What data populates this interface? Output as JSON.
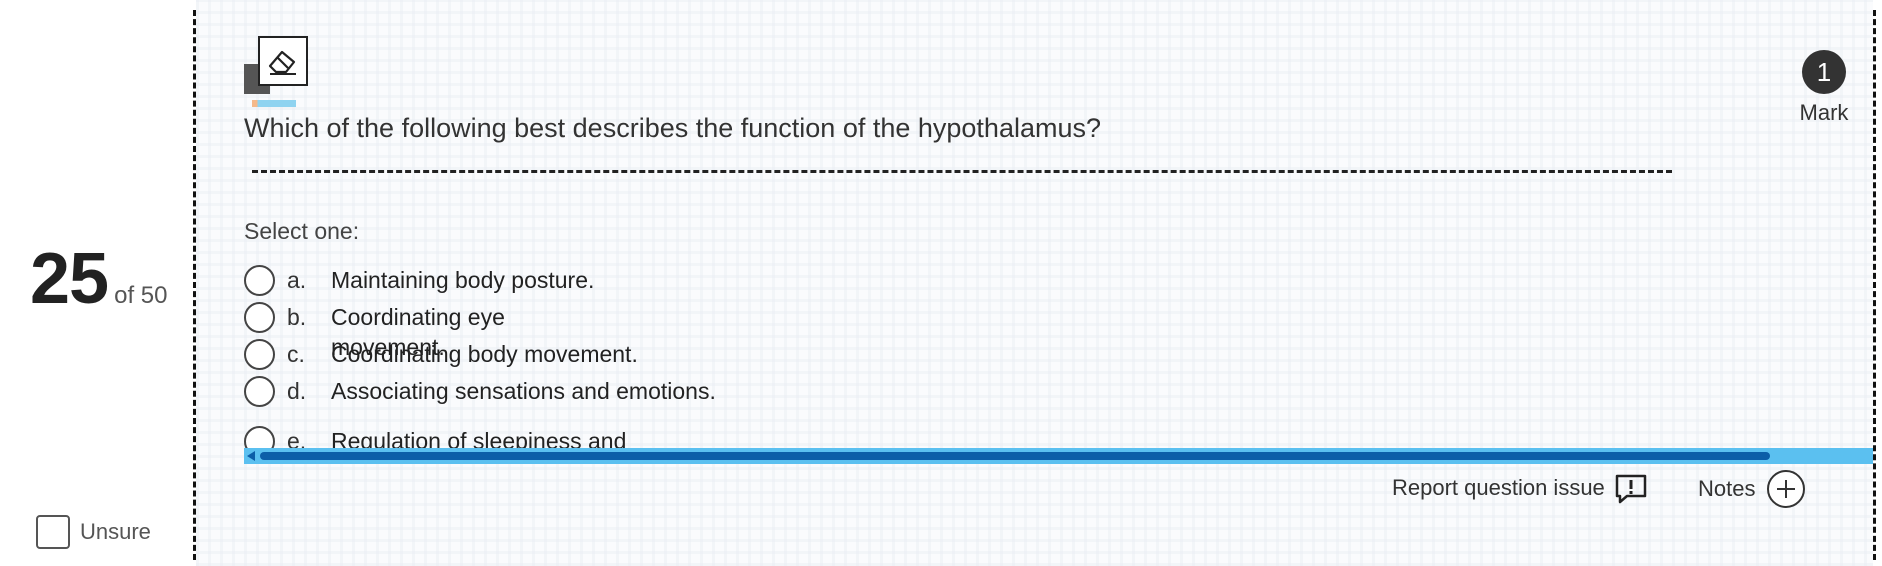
{
  "question_nav": {
    "number": "25",
    "of_total": "of 50",
    "unsure_label": "Unsure"
  },
  "question": {
    "text": "Which of the following best describes the function of the hypothalamus?",
    "marks": "1",
    "marks_label": "Mark",
    "select_label": "Select one:",
    "answers": [
      {
        "letter": "a.",
        "text": "Maintaining body posture."
      },
      {
        "letter": "b.",
        "text": "Coordinating eye movement."
      },
      {
        "letter": "c.",
        "text": "Coordinating body movement."
      },
      {
        "letter": "d.",
        "text": "Associating sensations and emotions."
      },
      {
        "letter": "e.",
        "text": "Regulation of sleepiness and"
      }
    ]
  },
  "footer": {
    "report_label": "Report question issue",
    "notes_label": "Notes"
  },
  "colors": {
    "scrollbar_track": "#5bc0f0",
    "scrollbar_thumb": "#0c5ea8",
    "mark_circle": "#333333"
  },
  "icons": {
    "eraser": "eraser-icon",
    "report": "report-issue-icon",
    "notes": "plus-icon"
  }
}
